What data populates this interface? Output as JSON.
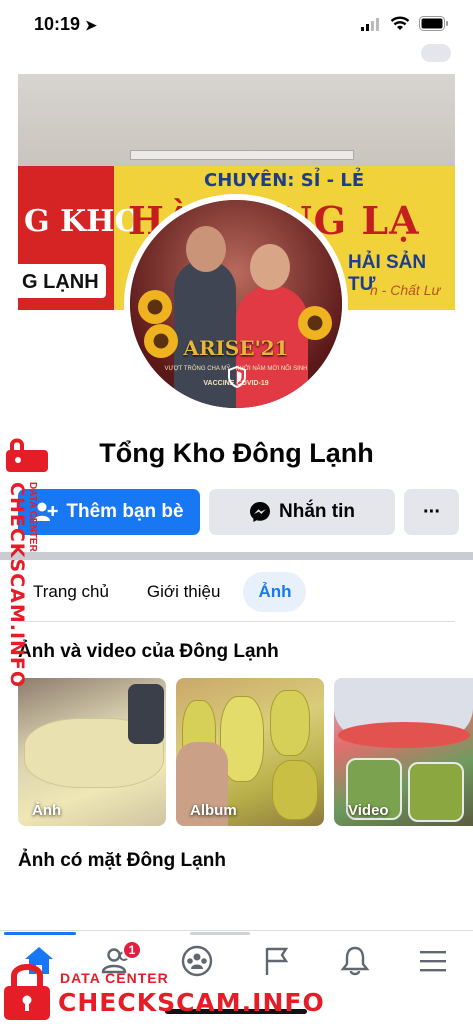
{
  "status_bar": {
    "time": "10:19"
  },
  "cover": {
    "banner_top": "CHUYÊN: SỈ - LẺ",
    "banner_main": "HÀ ĐÔNG LẠ",
    "banner_sub": "HẢI SẢN TƯ",
    "banner_tag": "n - Chất Lư",
    "red_panel": "G KHO",
    "red_box": "G LẠNH"
  },
  "avatar": {
    "frame_text": "ARISE'21",
    "frame_sub": "VƯỢT TRÔNG CHA MỸ - KHỞI NĂM MỚI NỐI SINH",
    "frame_vaccine": "VACCINE COVID-19"
  },
  "profile": {
    "name": "Tổng Kho Đông Lạnh"
  },
  "actions": {
    "add_friend": "Thêm bạn bè",
    "message": "Nhắn tin",
    "more": "···"
  },
  "tabs": [
    {
      "label": "Trang chủ",
      "active": false
    },
    {
      "label": "Giới thiệu",
      "active": false
    },
    {
      "label": "Ảnh",
      "active": true
    }
  ],
  "photos_section": {
    "title": "Ảnh và video của Đông Lạnh",
    "items": [
      {
        "caption": "Ảnh"
      },
      {
        "caption": "Album"
      },
      {
        "caption": "Video"
      }
    ]
  },
  "tagged_section": {
    "title": "Ảnh có mặt Đông Lạnh"
  },
  "bottom_nav": {
    "items": [
      {
        "icon": "home-icon",
        "active": true
      },
      {
        "icon": "friends-icon",
        "badge": "1"
      },
      {
        "icon": "groups-icon"
      },
      {
        "icon": "pages-flag-icon"
      },
      {
        "icon": "bell-icon"
      },
      {
        "icon": "menu-icon"
      }
    ]
  },
  "watermark": {
    "data_center": "DATA CENTER",
    "site": "CHECKSCAM.INFO"
  },
  "colors": {
    "accent": "#1877f2",
    "badge": "#e41e3f",
    "watermark": "#e51d26"
  }
}
